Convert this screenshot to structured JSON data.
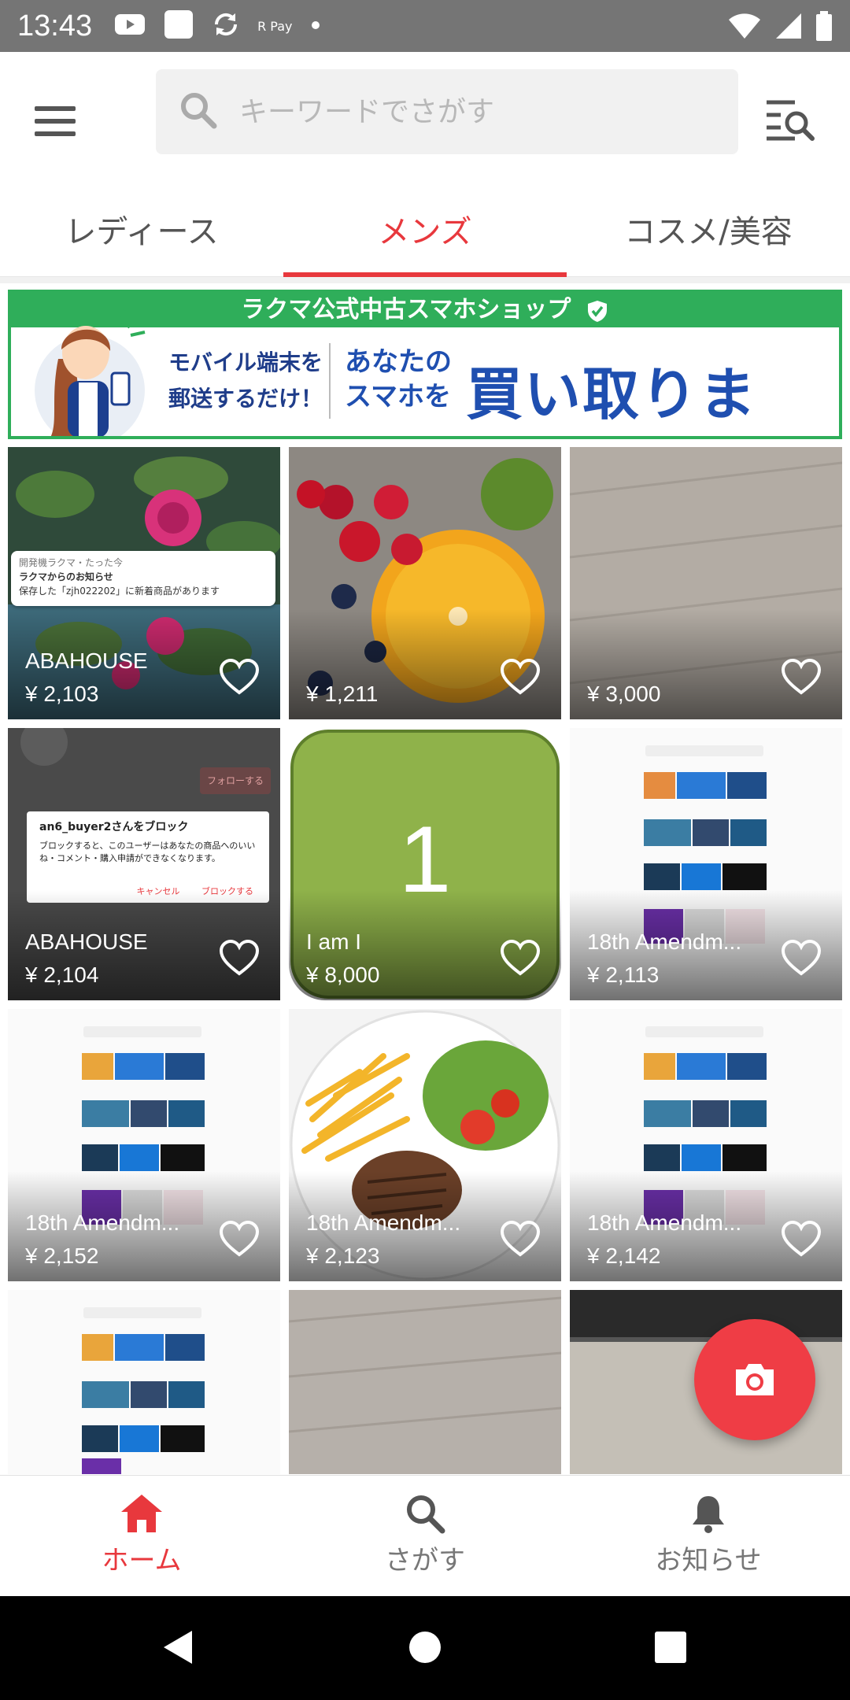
{
  "status_bar": {
    "time": "13:43",
    "pay_label": "R Pay"
  },
  "search": {
    "placeholder": "キーワードでさがす"
  },
  "tabs": [
    {
      "label": "レディース",
      "active": false
    },
    {
      "label": "メンズ",
      "active": true
    },
    {
      "label": "コスメ/美容",
      "active": false
    }
  ],
  "banner": {
    "title": "ラクマ公式中古スマホショップ",
    "left_line1": "モバイル端末を",
    "left_line2": "郵送するだけ！",
    "mid_line1": "あなたの",
    "mid_line2": "スマホを",
    "headline": "買い取ります！"
  },
  "items": [
    {
      "name": "ABAHOUSE",
      "price": "¥ 2,103"
    },
    {
      "name": "",
      "price": "¥ 1,211"
    },
    {
      "name": "",
      "price": "¥ 3,000"
    },
    {
      "name": "ABAHOUSE",
      "price": "¥ 2,104"
    },
    {
      "name": "I am I",
      "price": "¥ 8,000",
      "image_text": "1"
    },
    {
      "name": "18th Amendm...",
      "price": "¥ 2,113"
    },
    {
      "name": "18th Amendm...",
      "price": "¥ 2,152"
    },
    {
      "name": "18th Amendm...",
      "price": "¥ 2,123"
    },
    {
      "name": "18th Amendm...",
      "price": "¥ 2,142"
    },
    {
      "name": "",
      "price": ""
    },
    {
      "name": "",
      "price": ""
    },
    {
      "name": "",
      "price": ""
    }
  ],
  "notification_overlay": {
    "app": "開発機ラクマ・たった今",
    "title": "ラクマからのお知らせ",
    "body": "保存した「zjh022202」に新着商品があります"
  },
  "block_dialog": {
    "title": "an6_buyer2さんをブロック",
    "body": "ブロックすると、このユーザーはあなたの商品へのいいね・コメント・購入申請ができなくなります。",
    "cancel": "キャンセル",
    "confirm": "ブロックする",
    "follow": "フォローする"
  },
  "bottom_nav": [
    {
      "label": "ホーム",
      "active": true,
      "icon": "home-icon"
    },
    {
      "label": "さがす",
      "active": false,
      "icon": "search-icon"
    },
    {
      "label": "お知らせ",
      "active": false,
      "icon": "bell-icon"
    }
  ],
  "colors": {
    "accent": "#e8383d",
    "banner_green": "#2fae5a",
    "fab": "#ef3d45"
  }
}
